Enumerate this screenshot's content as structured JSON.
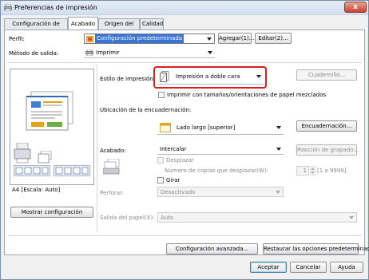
{
  "window": {
    "title": "Preferencias de impresión",
    "close_label": "x"
  },
  "tabs": [
    {
      "label": "Configuración de página"
    },
    {
      "label": "Acabado"
    },
    {
      "label": "Origen del papel"
    },
    {
      "label": "Calidad"
    }
  ],
  "profile": {
    "label": "Perfil:",
    "value": "Configuración predeterminada",
    "add_button": "Agregar(1)...",
    "edit_button": "Editar(2)..."
  },
  "output_method": {
    "label": "Método de salida:",
    "value": "Imprimir"
  },
  "preview": {
    "scale_text": "A4 [Escala: Auto]",
    "show_settings_button": "Mostrar configuración"
  },
  "print_style": {
    "label": "Estilo de impresión:",
    "value": "Impresión a doble cara",
    "booklet_button": "Cuadernillo...",
    "mixed_sizes_label": "Imprimir con tamaños/orientaciones de papel mezclados"
  },
  "binding": {
    "label": "Ubicación de la encuadernación:",
    "value": "Lado largo [superior]",
    "binding_button": "Encuadernación..."
  },
  "finishing": {
    "label": "Acabado:",
    "value": "Intercalar",
    "staple_button": "Posición de grapado...",
    "shift_label": "Desplazar",
    "shift_copies_label": "Número de copias que desplazar(W):",
    "shift_copies_value": "1",
    "shift_copies_range": "[1 a 9999]",
    "rotate_label": "Girar"
  },
  "punch": {
    "label": "Perforar:",
    "value": "Desactivado"
  },
  "paper_output": {
    "label": "Salida del papel(X):",
    "value": "Auto"
  },
  "footer": {
    "advanced_button": "Configuración avanzada...",
    "restore_button": "Restaurar las opciones predeterminadas",
    "ok_button": "Aceptar",
    "cancel_button": "Cancelar",
    "help_button": "Ayuda"
  },
  "colors": {
    "highlight": "#d91f1f",
    "profile_selection": "#3874d8",
    "accent_blue": "#3c7fb1"
  }
}
